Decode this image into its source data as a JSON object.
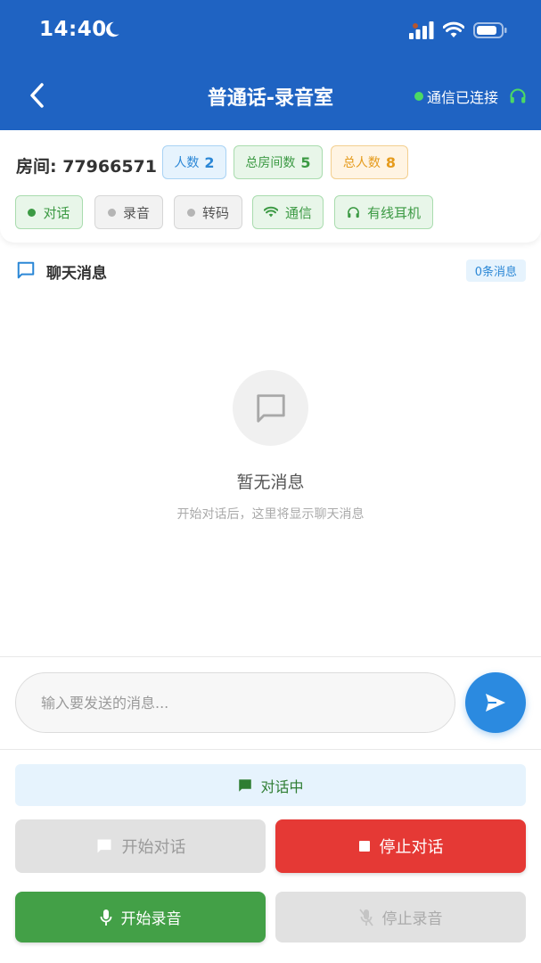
{
  "status_bar": {
    "time": "14:40"
  },
  "nav": {
    "title": "普通话-录音室",
    "connection": "通信已连接"
  },
  "room": {
    "label": "房间: 77966571",
    "badges": [
      {
        "label": "人数",
        "value": "2"
      },
      {
        "label": "总房间数",
        "value": "5"
      },
      {
        "label": "总人数",
        "value": "8"
      }
    ]
  },
  "chips": {
    "talk": "对话",
    "record": "录音",
    "transcode": "转码",
    "comm": "通信",
    "headset": "有线耳机"
  },
  "chat": {
    "title": "聊天消息",
    "count": "0条消息",
    "empty_title": "暂无消息",
    "empty_sub": "开始对话后，这里将显示聊天消息"
  },
  "input": {
    "placeholder": "输入要发送的消息..."
  },
  "controls": {
    "status": "对话中",
    "start_talk": "开始对话",
    "stop_talk": "停止对话",
    "start_record": "开始录音",
    "stop_record": "停止录音"
  },
  "colors": {
    "primary": "#1f63c2",
    "green": "#43a047",
    "red": "#e53935",
    "send": "#2b8ae0"
  }
}
